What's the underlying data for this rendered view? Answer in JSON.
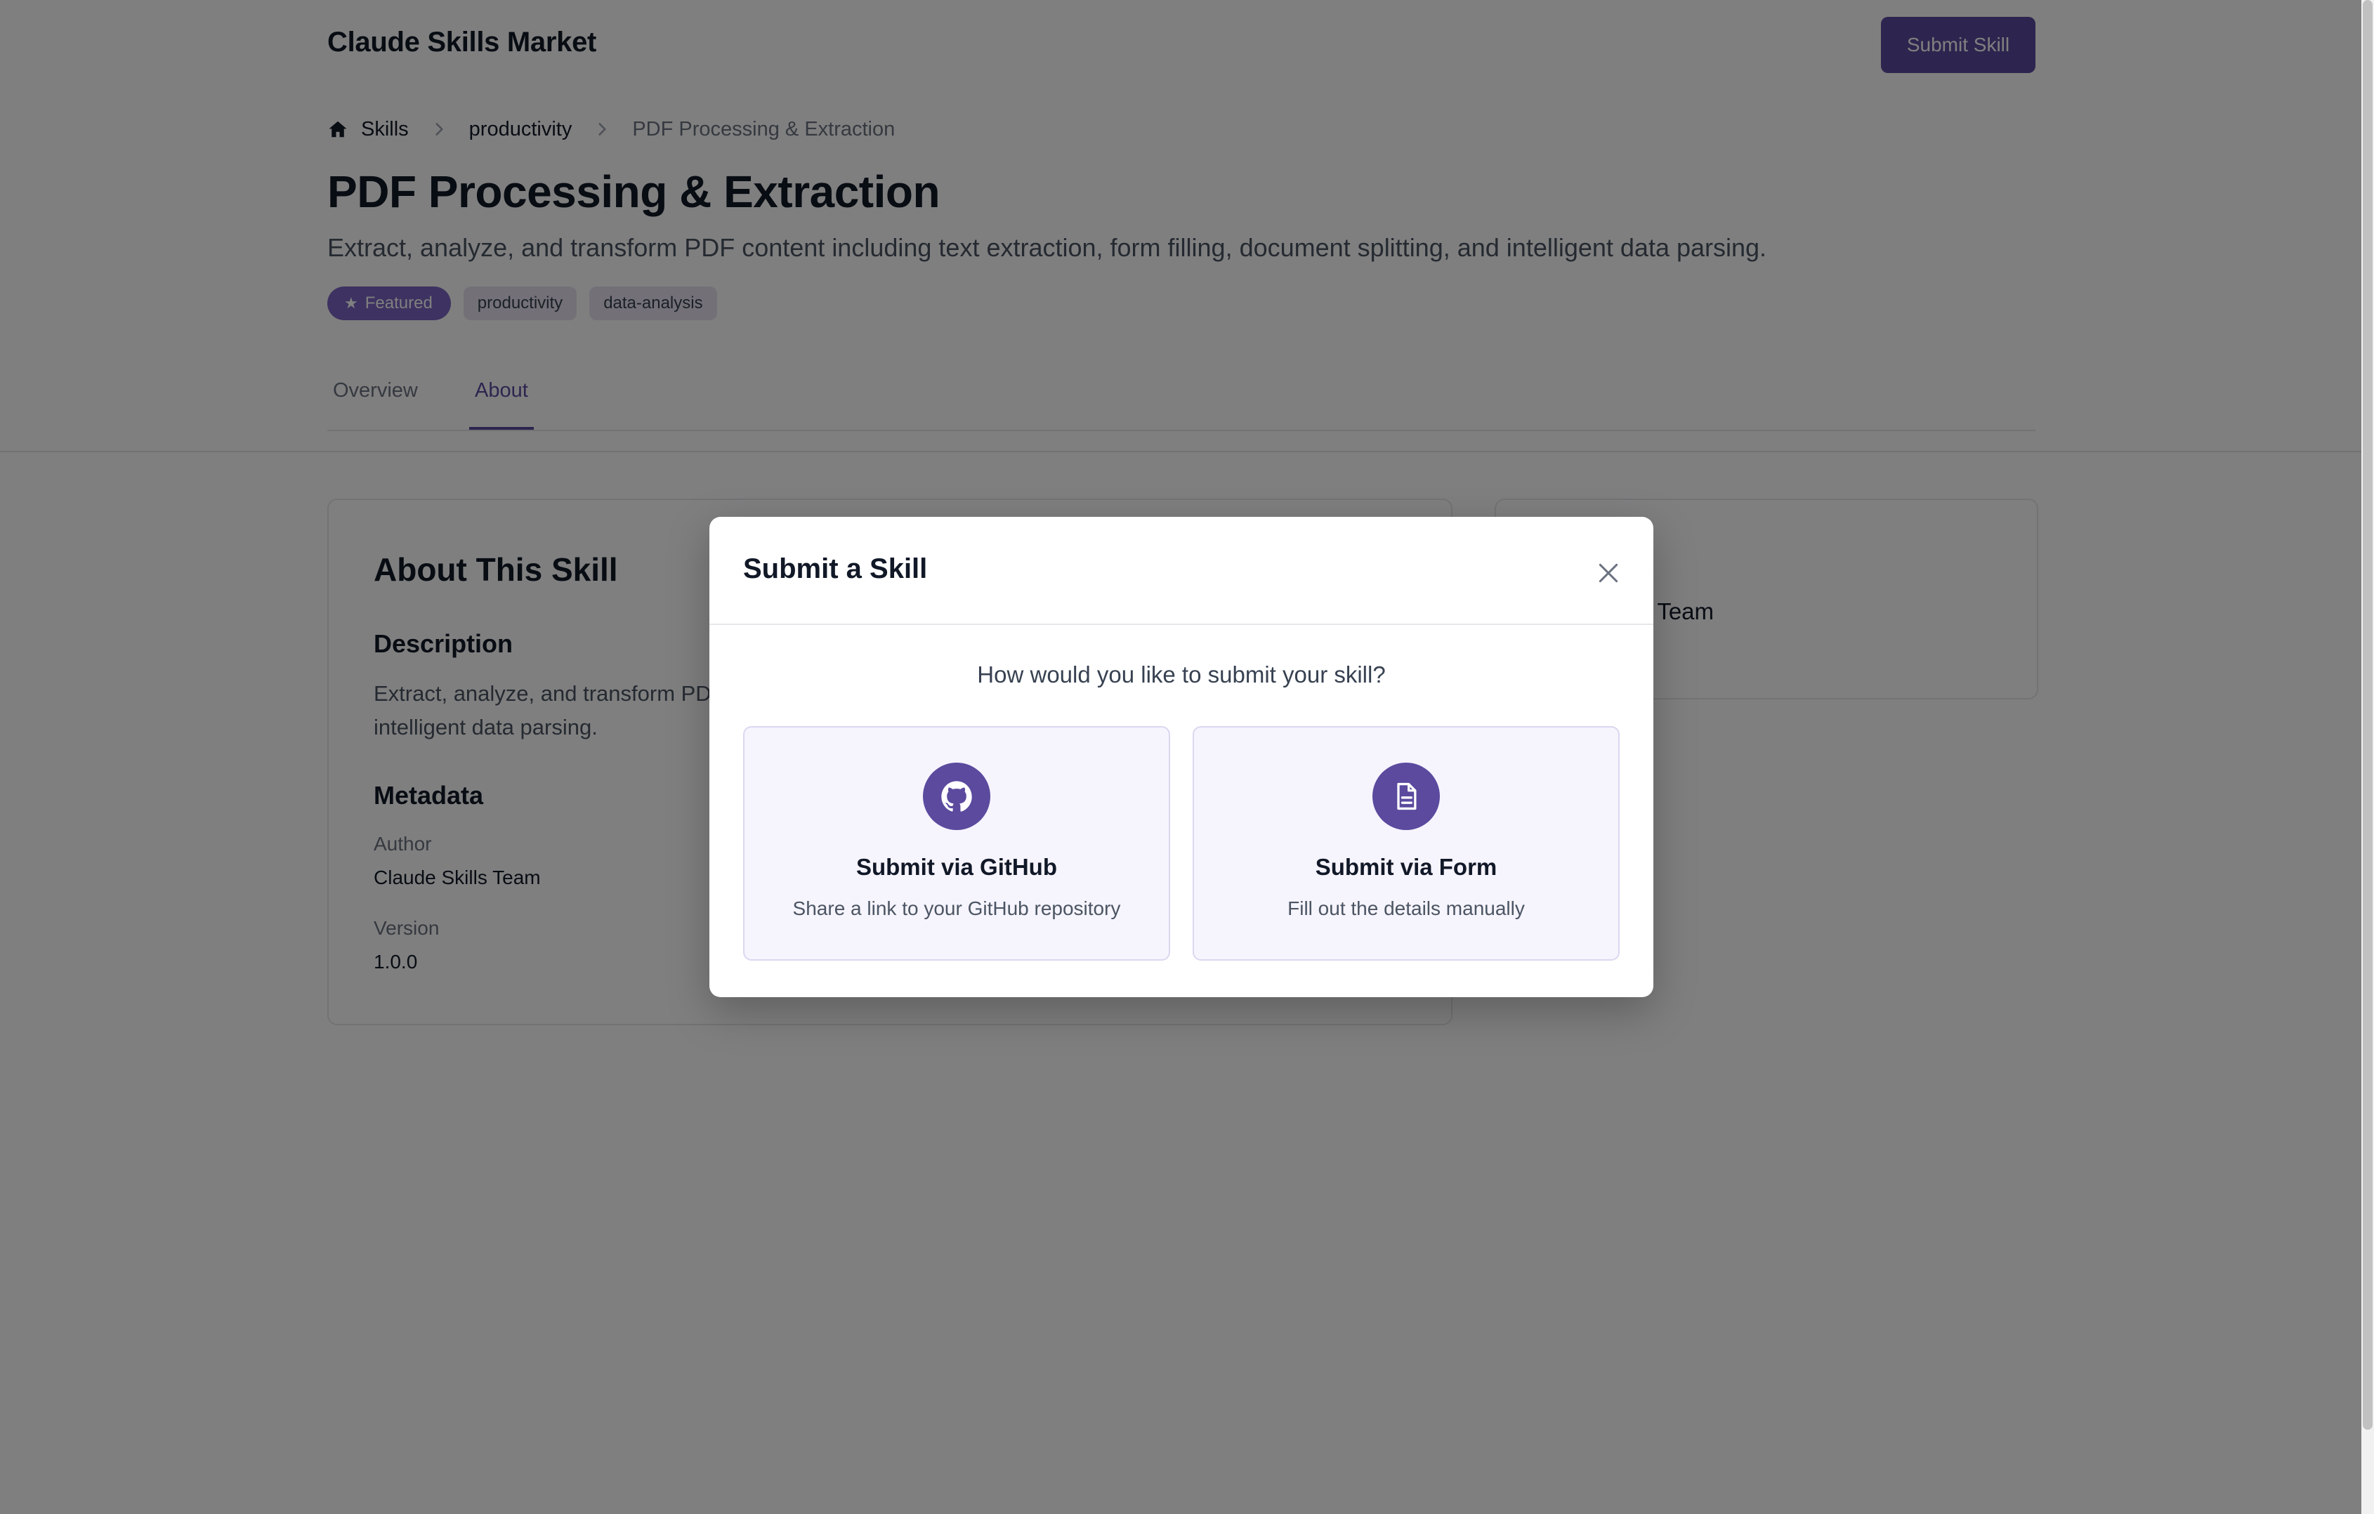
{
  "header": {
    "brand": "Claude Skills Market",
    "submit_label": "Submit Skill"
  },
  "breadcrumb": {
    "home_icon": "home-icon",
    "items": [
      "Skills",
      "productivity",
      "PDF Processing & Extraction"
    ]
  },
  "skill": {
    "title": "PDF Processing & Extraction",
    "subtitle": "Extract, analyze, and transform PDF content including text extraction, form filling, document splitting, and intelligent data parsing.",
    "tags": {
      "featured": "Featured",
      "items": [
        "productivity",
        "data-analysis"
      ]
    }
  },
  "tabs": {
    "items": [
      "Overview",
      "About"
    ],
    "active": "About"
  },
  "about": {
    "title": "About This Skill",
    "description_heading": "Description",
    "description_text": "Extract, analyze, and transform PDF content including text extraction, form filling, document splitting, and intelligent data parsing.",
    "metadata_heading": "Metadata",
    "author_label": "Author",
    "author_value": "Claude Skills Team",
    "version_label": "Version",
    "version_value": "1.0.0"
  },
  "side_panel": {
    "author_value": "Claude Skills Team"
  },
  "modal": {
    "title": "Submit a Skill",
    "question": "How would you like to submit your skill?",
    "options": [
      {
        "title": "Submit via GitHub",
        "subtitle": "Share a link to your GitHub repository",
        "icon": "github-icon"
      },
      {
        "title": "Submit via Form",
        "subtitle": "Fill out the details manually",
        "icon": "document-icon"
      }
    ]
  },
  "colors": {
    "accent": "#5b4a9e",
    "featured_tag": "#7b64c2",
    "option_bg": "#f6f4fd",
    "overlay": "rgba(0,0,0,0.5)"
  }
}
